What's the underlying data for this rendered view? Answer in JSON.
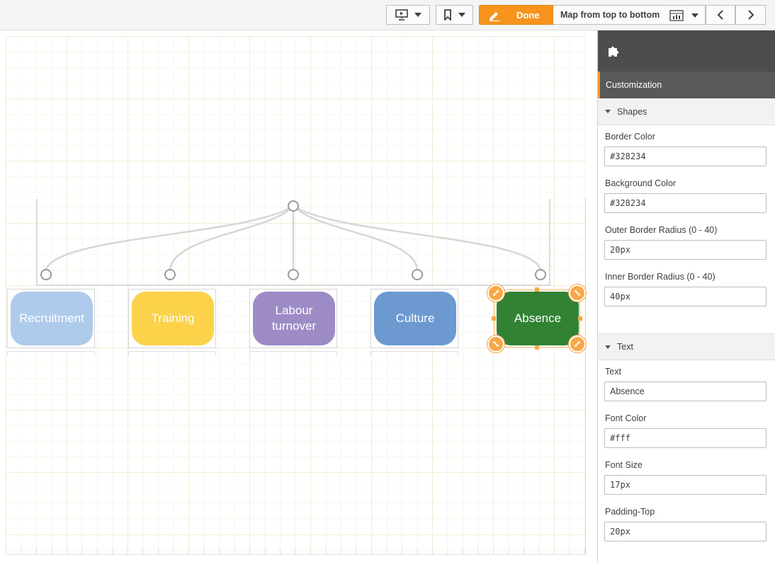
{
  "toolbar": {
    "presentation_icon": "presentation-play-icon",
    "bookmark_icon": "bookmark-icon",
    "edit_icon": "pencil-icon",
    "done_label": "Done",
    "mapping_label": "Map from top to bottom",
    "mapping_icon": "chart-table-icon",
    "back_icon": "chevron-left-icon",
    "forward_icon": "chevron-right-icon",
    "accent_color": "#f7941d"
  },
  "tree": {
    "nodes": [
      {
        "label": "Recruitment",
        "color": "#aecbeb"
      },
      {
        "label": "Training",
        "color": "#fbd24a"
      },
      {
        "label": "Labour\nturnover",
        "color": "#9d8bc6"
      },
      {
        "label": "Culture",
        "color": "#6c9ad0"
      },
      {
        "label": "Absence",
        "color": "#328234",
        "selected": true
      }
    ]
  },
  "panel": {
    "extension_icon": "puzzle-piece-icon",
    "customization_label": "Customization",
    "shapes_section": {
      "title": "Shapes",
      "border_color_label": "Border Color",
      "border_color_value": "#328234",
      "background_color_label": "Background Color",
      "background_color_value": "#328234",
      "outer_radius_label": "Outer Border Radius (0 - 40)",
      "outer_radius_value": "20px",
      "inner_radius_label": "Inner Border Radius (0 - 40)",
      "inner_radius_value": "40px"
    },
    "text_section": {
      "title": "Text",
      "text_label": "Text",
      "text_value": "Absence",
      "font_color_label": "Font Color",
      "font_color_value": "#fff",
      "font_size_label": "Font Size",
      "font_size_value": "17px",
      "padding_top_label": "Padding-Top",
      "padding_top_value": "20px"
    }
  }
}
